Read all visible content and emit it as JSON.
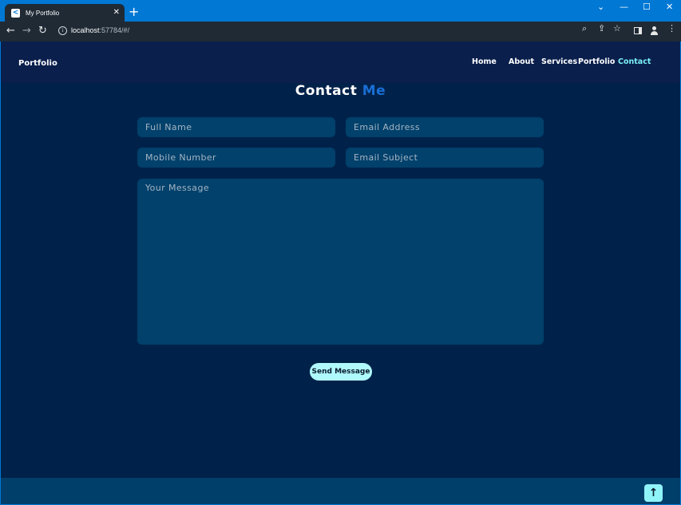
{
  "browser": {
    "tab_title": "My Portfolio",
    "tab_close": "✕",
    "new_tab": "+",
    "url_host": "localhost",
    "url_rest": ":57784/#/",
    "window_controls": {
      "tabs_menu": "⌄",
      "minimize": "—",
      "maximize": "☐",
      "close": "✕"
    }
  },
  "header": {
    "brand": "Portfolio",
    "nav": [
      "Home",
      "About",
      "Services",
      "Portfolio",
      "Contact"
    ],
    "active_nav": "Contact"
  },
  "contact": {
    "title_main": "Contact",
    "title_accent": "Me",
    "placeholders": {
      "full_name": "Full Name",
      "email": "Email Address",
      "mobile": "Mobile Number",
      "subject": "Email Subject",
      "message": "Your Message"
    },
    "send_label": "Send Message"
  },
  "footer": {
    "scroll_top_icon": "↑"
  },
  "colors": {
    "page_bg": "#00224a",
    "header_bg": "#0a1f4c",
    "field_bg": "#01416c",
    "accent_cyan": "#7cf1f6",
    "accent_blue": "#1a6fd6",
    "button_bg": "#aff9fc",
    "footer_bg": "#013f6b"
  }
}
